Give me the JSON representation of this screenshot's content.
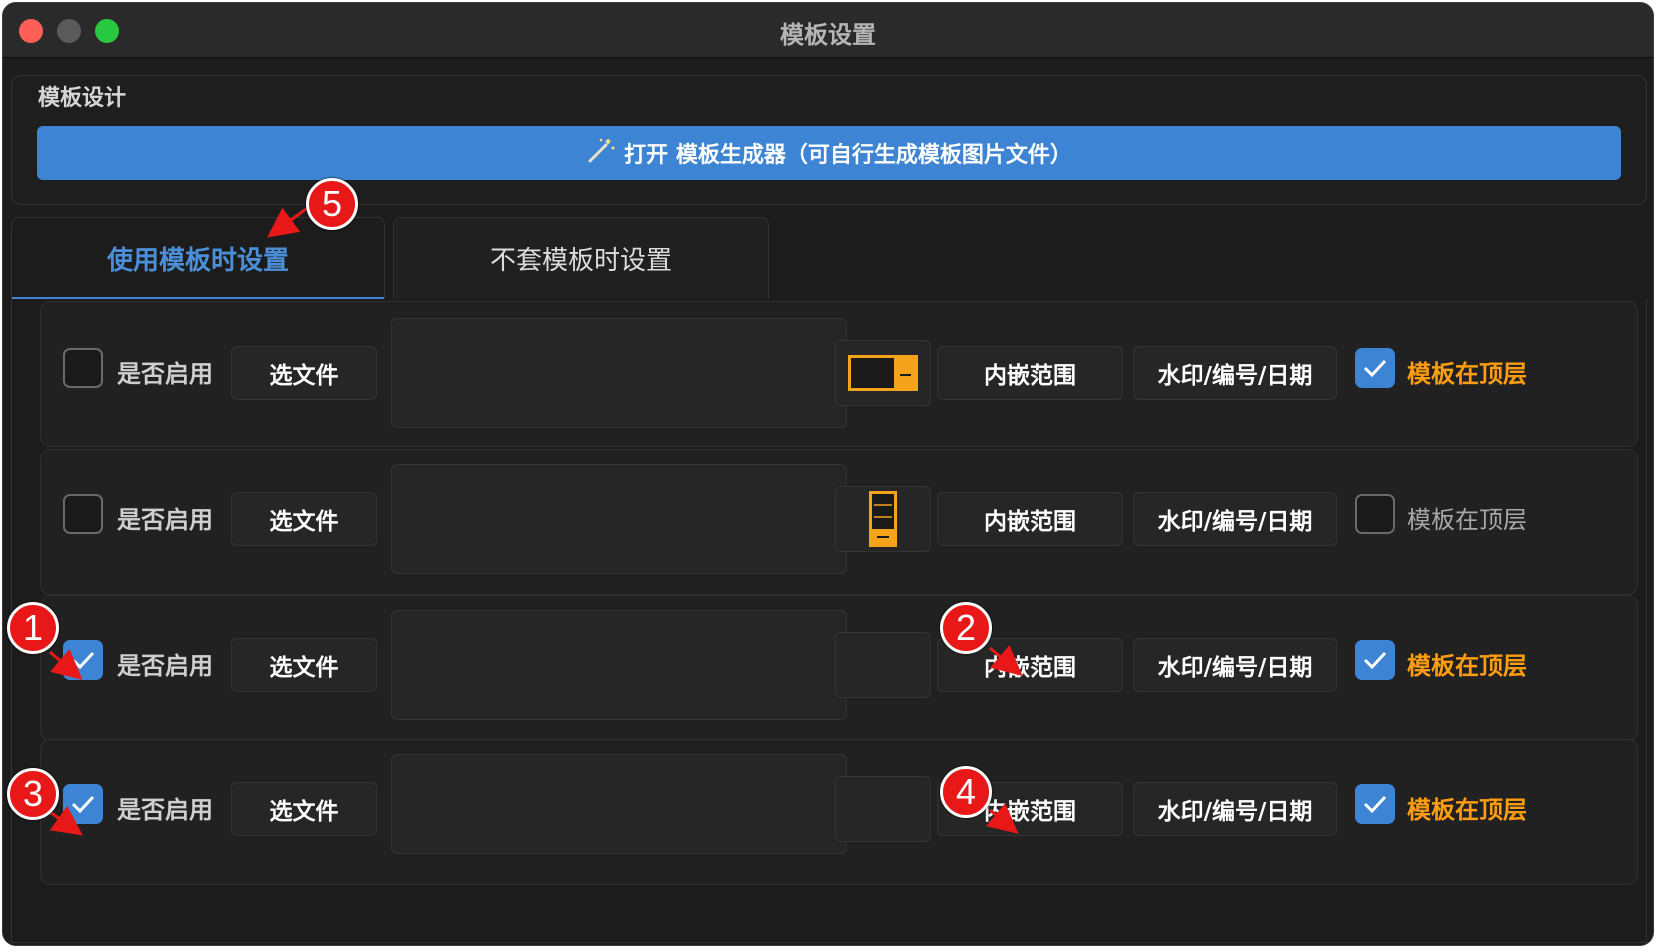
{
  "window": {
    "title": "模板设置"
  },
  "design_group": {
    "label": "模板设计",
    "generator_button": "打开 模板生成器（可自行生成模板图片文件）"
  },
  "tabs": [
    {
      "label": "使用模板时设置",
      "active": true
    },
    {
      "label": "不套模板时设置",
      "active": false
    }
  ],
  "rows": [
    {
      "enable_label": "是否启用",
      "enabled": false,
      "file_button": "选文件",
      "orientation": "landscape",
      "embed_button": "内嵌范围",
      "watermark_button": "水印/编号/日期",
      "top_label": "模板在顶层",
      "top_checked": true
    },
    {
      "enable_label": "是否启用",
      "enabled": false,
      "file_button": "选文件",
      "orientation": "portrait",
      "embed_button": "内嵌范围",
      "watermark_button": "水印/编号/日期",
      "top_label": "模板在顶层",
      "top_checked": false
    },
    {
      "enable_label": "是否启用",
      "enabled": true,
      "file_button": "选文件",
      "orientation": "none",
      "embed_button": "内嵌范围",
      "watermark_button": "水印/编号/日期",
      "top_label": "模板在顶层",
      "top_checked": true
    },
    {
      "enable_label": "是否启用",
      "enabled": true,
      "file_button": "选文件",
      "orientation": "none",
      "embed_button": "内嵌范围",
      "watermark_button": "水印/编号/日期",
      "top_label": "模板在顶层",
      "top_checked": true
    }
  ],
  "callouts": [
    "1",
    "2",
    "3",
    "4",
    "5"
  ],
  "colors": {
    "accent": "#3d85d4",
    "orange": "#ff9d12",
    "badge": "#e81818"
  }
}
